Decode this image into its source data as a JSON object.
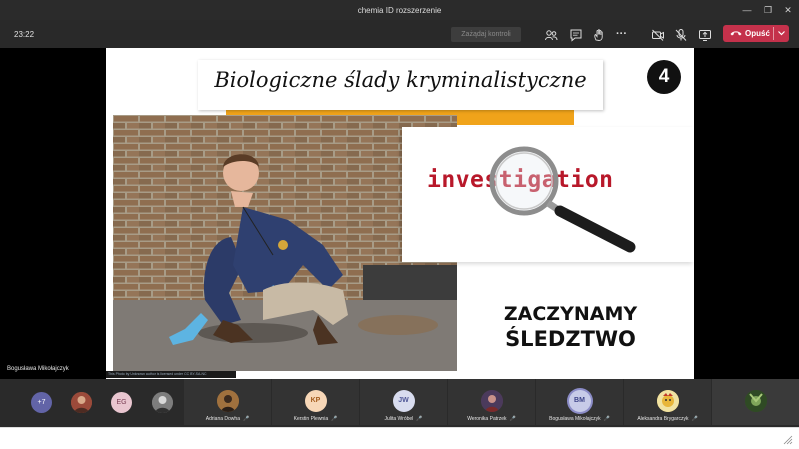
{
  "window": {
    "title": "chemia ID rozszerzenie"
  },
  "toolbar": {
    "timer": "23:22",
    "take_control_label": "Zażądaj kontroli",
    "leave_label": "Opuść"
  },
  "slide": {
    "title": "Biologiczne ślady kryminalistyczne",
    "number": "4",
    "investigation_text": "investigation",
    "line1": "ZACZYNAMY",
    "line2": "ŚLEDZTWO",
    "photo_credit": "This Photo by Unknown author is licensed under CC BY-SA-NC"
  },
  "presenter_name": "Bogusława Mikołajczyk",
  "participants_mini": [
    {
      "initials": "+7",
      "color": "#6264a7"
    },
    {
      "initials": "",
      "color": "#8a5a3a"
    },
    {
      "initials": "EG",
      "color": "#e9c6d0"
    },
    {
      "initials": "",
      "color": "#6b6b6b"
    }
  ],
  "participants": [
    {
      "name": "Adriana Dowha",
      "initials": "",
      "color": "#7a5b36"
    },
    {
      "name": "Kerstin Plewnia",
      "initials": "KP",
      "color": "#f7d7b7"
    },
    {
      "name": "Julita Wróbel",
      "initials": "JW",
      "color": "#d8dcef"
    },
    {
      "name": "Weronika Patrzek",
      "initials": "",
      "color": "#5a3b4b"
    },
    {
      "name": "Bogusława Mikołajczyk",
      "initials": "BM",
      "color": "#c7cbe8"
    },
    {
      "name": "Aleksandra Brygarczyk",
      "initials": "",
      "color": "#d9a441"
    }
  ],
  "colors": {
    "accent_red": "#c4314b",
    "orange": "#f0a31a",
    "investigation_red": "#b8182a"
  }
}
